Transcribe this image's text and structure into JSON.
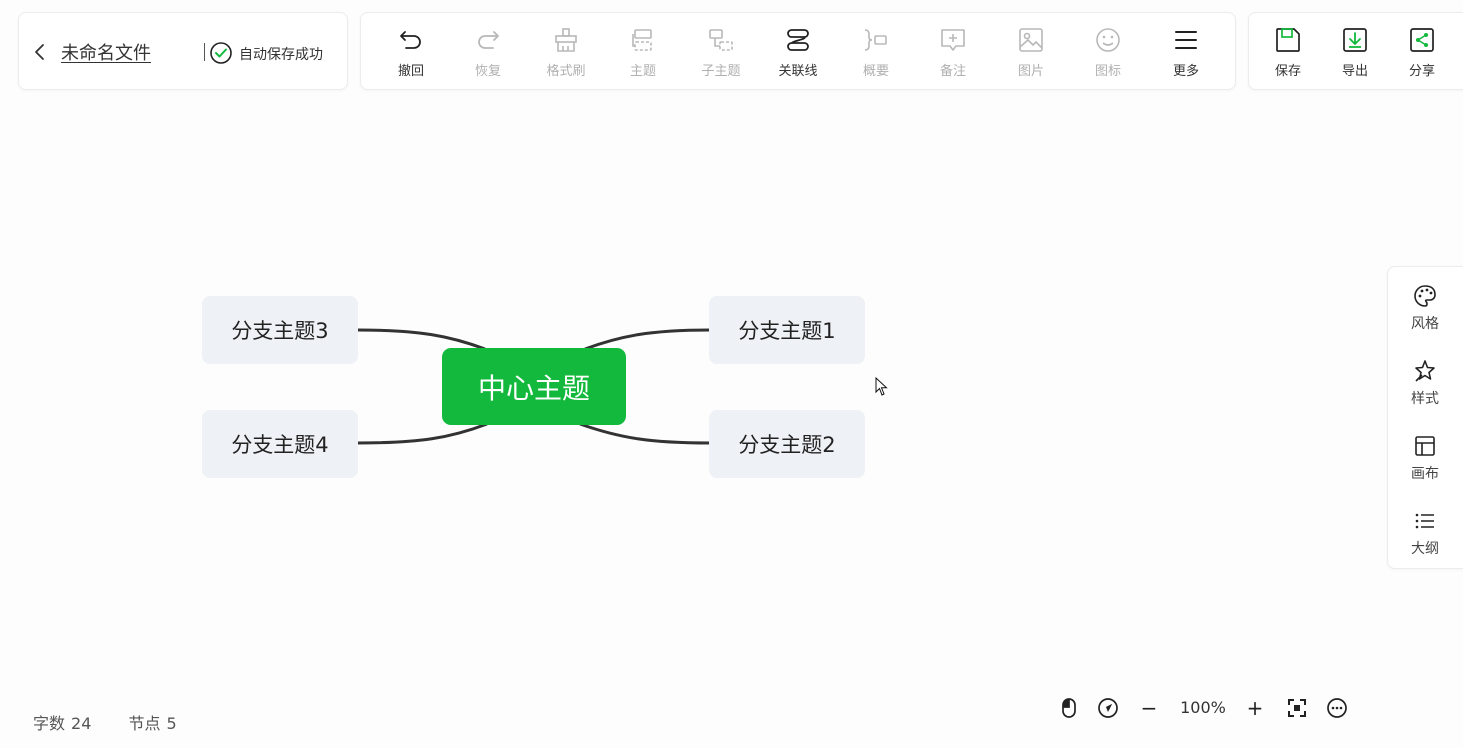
{
  "document": {
    "title": "未命名文件",
    "save_status": "自动保存成功"
  },
  "toolbar": {
    "items": [
      {
        "label": "撤回",
        "icon": "undo-icon",
        "enabled": true
      },
      {
        "label": "恢复",
        "icon": "redo-icon",
        "enabled": false
      },
      {
        "label": "格式刷",
        "icon": "format-brush-icon",
        "enabled": false
      },
      {
        "label": "主题",
        "icon": "topic-icon",
        "enabled": false
      },
      {
        "label": "子主题",
        "icon": "subtopic-icon",
        "enabled": false
      },
      {
        "label": "关联线",
        "icon": "relation-line-icon",
        "enabled": true
      },
      {
        "label": "概要",
        "icon": "summary-icon",
        "enabled": false
      },
      {
        "label": "备注",
        "icon": "note-icon",
        "enabled": false
      },
      {
        "label": "图片",
        "icon": "image-icon",
        "enabled": false
      },
      {
        "label": "图标",
        "icon": "emoji-icon",
        "enabled": false
      },
      {
        "label": "更多",
        "icon": "menu-icon",
        "enabled": true
      }
    ]
  },
  "toolbar_right": {
    "items": [
      {
        "label": "保存",
        "icon": "save-icon"
      },
      {
        "label": "导出",
        "icon": "export-icon"
      },
      {
        "label": "分享",
        "icon": "share-icon"
      }
    ]
  },
  "side_panel": {
    "items": [
      {
        "label": "风格",
        "icon": "palette-icon"
      },
      {
        "label": "样式",
        "icon": "style-icon"
      },
      {
        "label": "画布",
        "icon": "canvas-layout-icon"
      },
      {
        "label": "大纲",
        "icon": "outline-list-icon"
      }
    ]
  },
  "mindmap": {
    "center": "中心主题",
    "branches": [
      "分支主题1",
      "分支主题2",
      "分支主题3",
      "分支主题4"
    ]
  },
  "status": {
    "word_count_label": "字数",
    "word_count": "24",
    "node_count_label": "节点",
    "node_count": "5"
  },
  "zoom": {
    "level": "100%",
    "minus": "−",
    "plus": "+"
  },
  "colors": {
    "accent": "#13b93c",
    "branch_bg": "#eef1f5",
    "link": "#333333",
    "disabled_text": "#b0b0b0"
  }
}
